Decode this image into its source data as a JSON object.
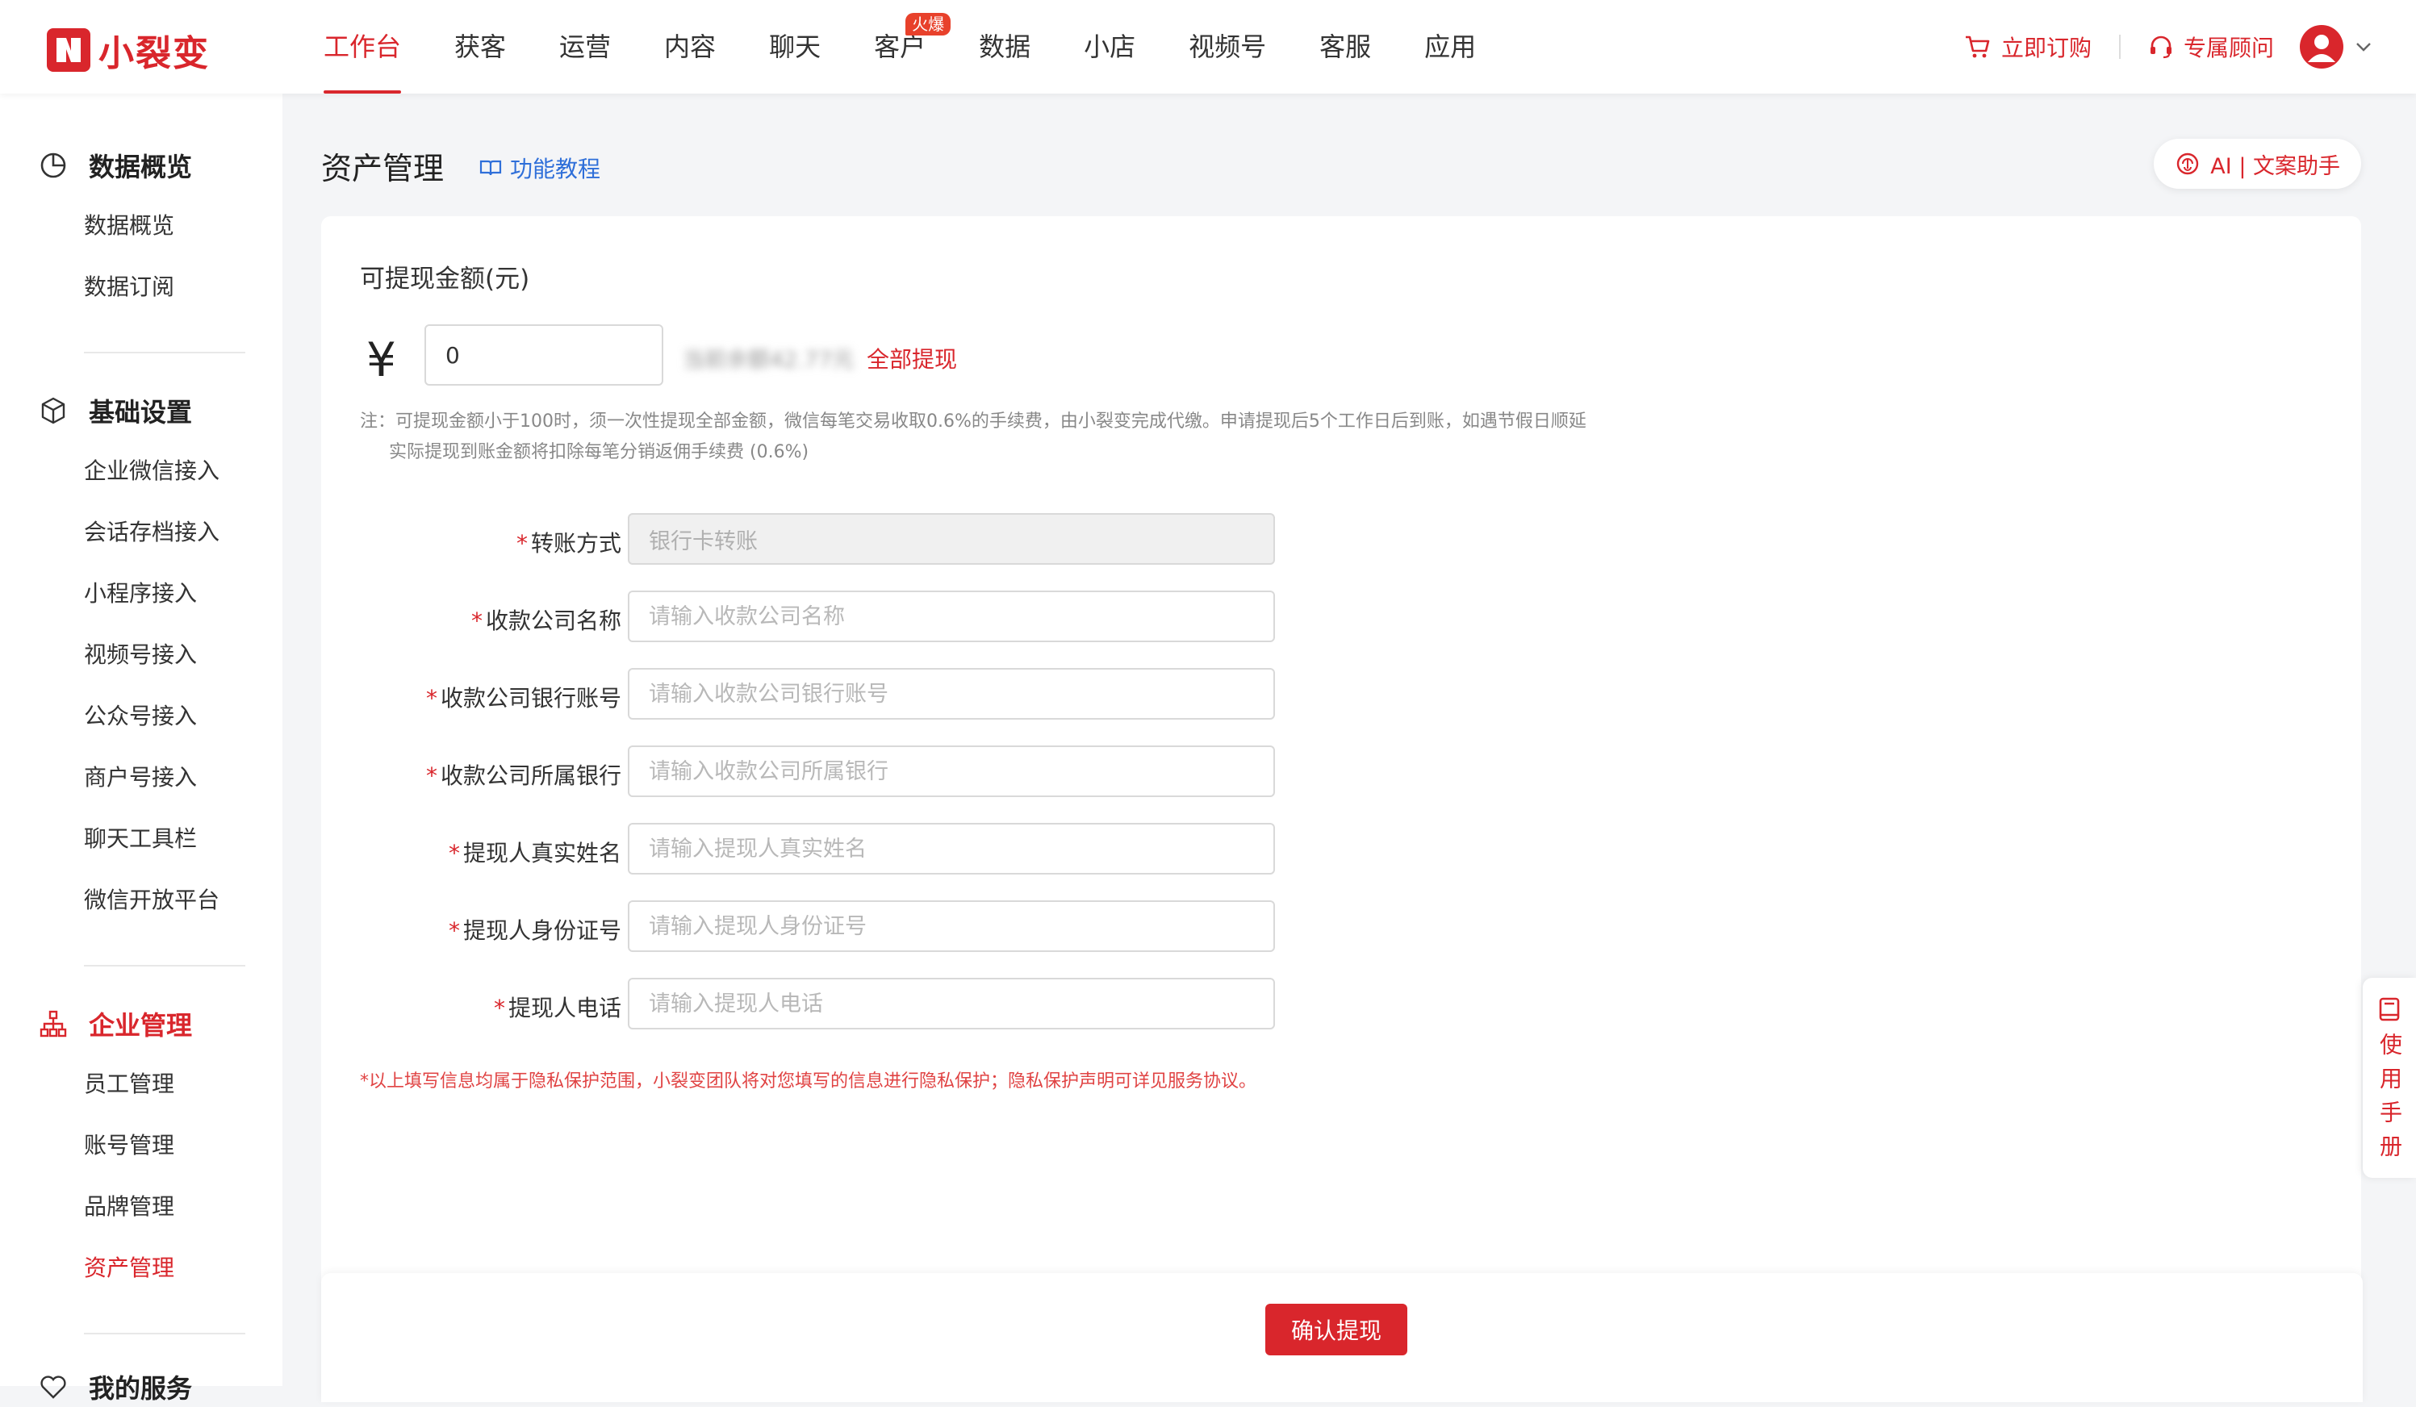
{
  "brand": {
    "name": "小裂变",
    "color": "#d9262c"
  },
  "nav": {
    "items": [
      {
        "label": "工作台",
        "active": true
      },
      {
        "label": "获客"
      },
      {
        "label": "运营"
      },
      {
        "label": "内容"
      },
      {
        "label": "聊天"
      },
      {
        "label": "客户",
        "badge": "火爆"
      },
      {
        "label": "数据"
      },
      {
        "label": "小店"
      },
      {
        "label": "视频号"
      },
      {
        "label": "客服"
      },
      {
        "label": "应用"
      }
    ],
    "subscribe": "立即订购",
    "consultant": "专属顾问"
  },
  "sidebar": {
    "groups": [
      {
        "title": "数据概览",
        "icon": "pie-chart-icon",
        "items": [
          "数据概览",
          "数据订阅"
        ]
      },
      {
        "title": "基础设置",
        "icon": "cube-icon",
        "items": [
          "企业微信接入",
          "会话存档接入",
          "小程序接入",
          "视频号接入",
          "公众号接入",
          "商户号接入",
          "聊天工具栏",
          "微信开放平台"
        ]
      },
      {
        "title": "企业管理",
        "icon": "org-chart-icon",
        "items": [
          "员工管理",
          "账号管理",
          "品牌管理",
          "资产管理"
        ],
        "active_item": "资产管理"
      },
      {
        "title": "我的服务",
        "icon": "heart-icon"
      }
    ]
  },
  "page": {
    "title": "资产管理",
    "tutorial": "功能教程",
    "ai_assistant": "AI | 文案助手"
  },
  "withdraw": {
    "amount_label": "可提现金额(元)",
    "currency_symbol": "¥",
    "amount_value": "0",
    "balance_text": "当前余额42.77元",
    "withdraw_all": "全部提现",
    "note_line1": "注：可提现金额小于100时，须一次性提现全部金额，微信每笔交易收取0.6%的手续费，由小裂变完成代缴。申请提现后5个工作日后到账，如遇节假日顺延",
    "note_line2": "实际提现到账金额将扣除每笔分销返佣手续费 (0.6%)"
  },
  "form": {
    "fields": [
      {
        "label": "转账方式",
        "value": "银行卡转账",
        "disabled": true
      },
      {
        "label": "收款公司名称",
        "placeholder": "请输入收款公司名称"
      },
      {
        "label": "收款公司银行账号",
        "placeholder": "请输入收款公司银行账号"
      },
      {
        "label": "收款公司所属银行",
        "placeholder": "请输入收款公司所属银行"
      },
      {
        "label": "提现人真实姓名",
        "placeholder": "请输入提现人真实姓名"
      },
      {
        "label": "提现人身份证号",
        "placeholder": "请输入提现人身份证号"
      },
      {
        "label": "提现人电话",
        "placeholder": "请输入提现人电话"
      }
    ],
    "required_mark": "*",
    "privacy_note": "*以上填写信息均属于隐私保护范围，小裂变团队将对您填写的信息进行隐私保护；隐私保护声明可详见服务协议。",
    "confirm_button": "确认提现"
  },
  "manual_tab": "使用手册"
}
